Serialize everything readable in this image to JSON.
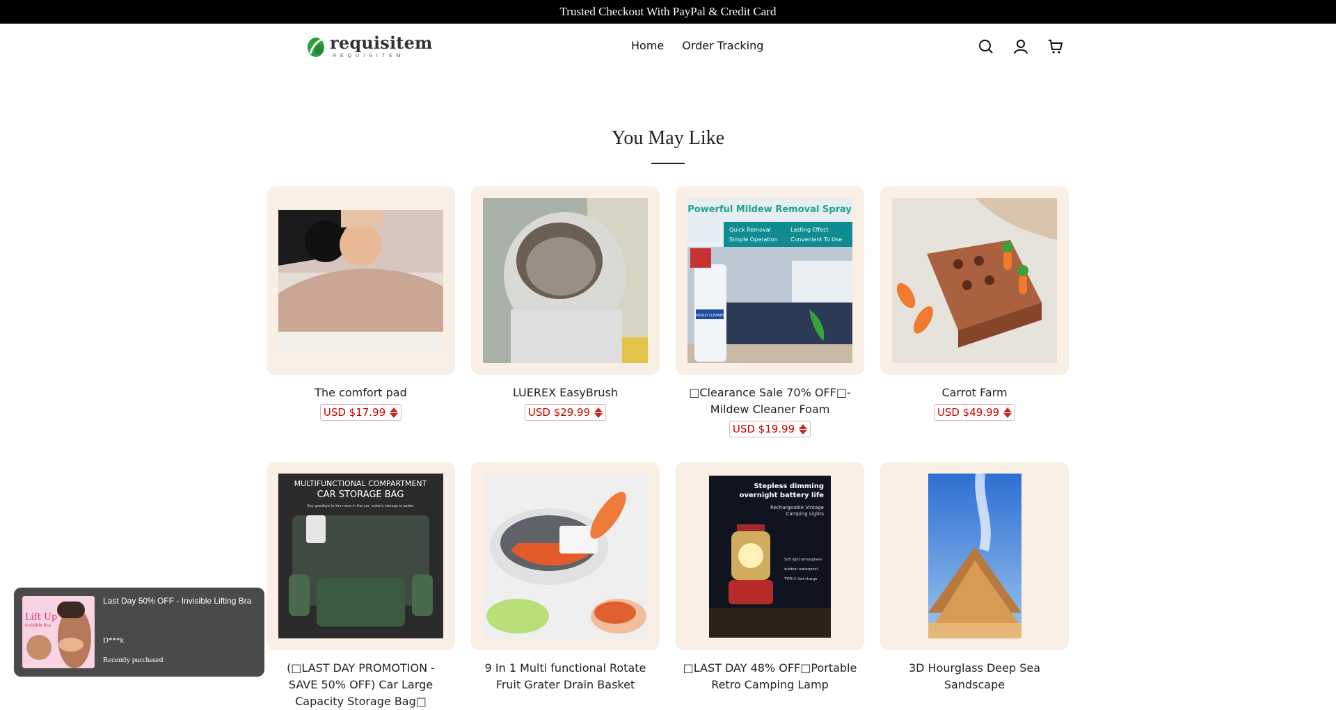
{
  "announcement": "Trusted Checkout With PayPal & Credit Card",
  "brand": {
    "name": "requisitem",
    "tagline": "REQUISITEM",
    "color": "#2e9e3e"
  },
  "nav": [
    {
      "label": "Home"
    },
    {
      "label": "Order Tracking"
    }
  ],
  "header_icons": [
    "search-icon",
    "account-icon",
    "cart-icon"
  ],
  "section_title": "You May Like",
  "accent_price_color": "#cc0000",
  "products": [
    {
      "title": "The comfort pad",
      "price": "USD $17.99"
    },
    {
      "title": "LUEREX EasyBrush",
      "price": "USD $29.99"
    },
    {
      "title": "Clearance Sale 70% OFF-Mildew Cleaner Foam",
      "price": "USD $19.99",
      "prefix": "□",
      "mid": "□"
    },
    {
      "title": "Carrot Farm",
      "price": "USD $49.99"
    },
    {
      "title": "(□LAST DAY PROMOTION - SAVE 50% OFF) Car Large Capacity Storage Bag□",
      "price": ""
    },
    {
      "title": "9 In 1 Multi functional Rotate Fruit Grater Drain Basket",
      "price": ""
    },
    {
      "title": "□LAST DAY 48% OFF□Portable Retro Camping Lamp",
      "price": ""
    },
    {
      "title": "3D Hourglass Deep Sea Sandscape",
      "price": ""
    }
  ],
  "image_text": {
    "mildew_headline": "Powerful Mildew Removal Spray",
    "mildew_features": [
      "Quick Removal",
      "Lasting Effect",
      "Simple Operation",
      "Convenient To Use"
    ],
    "mildew_bottle": "MOULD CLEANER",
    "carbag_line1": "MULTIFUNCTIONAL COMPARTMENT",
    "carbag_line2": "CAR STORAGE BAG",
    "carbag_sub": "Say goodbye to the mess in the car, orderly storage is easier",
    "lamp_line1": "Stepless dimming",
    "lamp_line2": "overnight battery life",
    "lamp_line3": "Rechargeable Vintage",
    "lamp_line4": "Camping Lights",
    "lamp_feat1": "Soft light atmosphere",
    "lamp_feat2": "outdoor waterproof",
    "lamp_feat3": "TYPE-C fast charge",
    "lift_up": "Lift Up",
    "lift_sub": "Invisible Bra"
  },
  "popup": {
    "title": "Last Day 50% OFF - Invisible Lifting Bra",
    "customer": "D***k",
    "status": "Recently purchased"
  }
}
